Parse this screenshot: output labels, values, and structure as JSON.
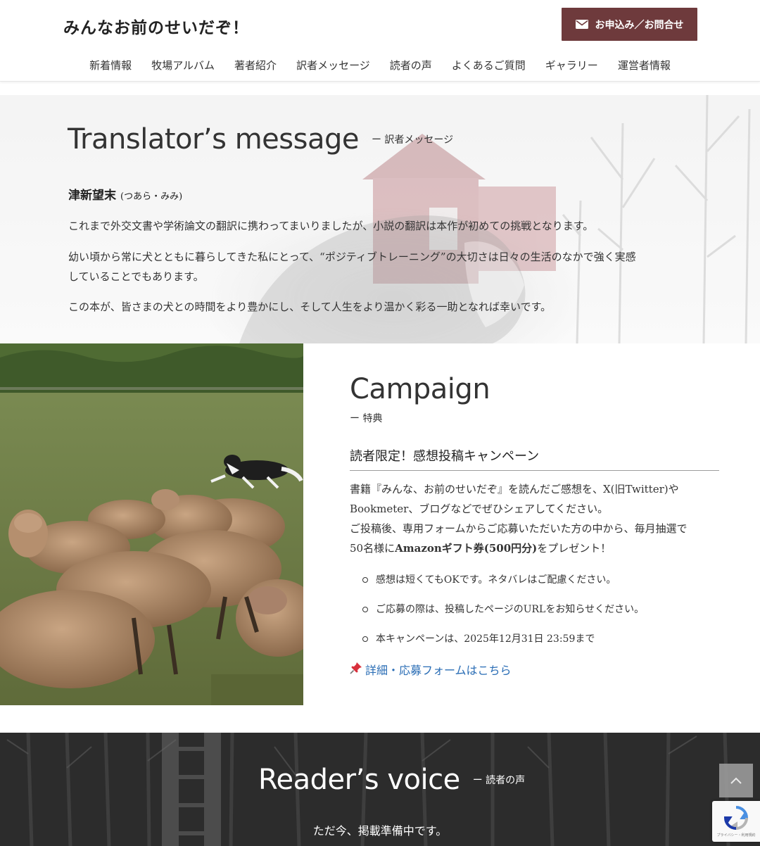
{
  "header": {
    "site_title": "みんなお前のせいだぞ！",
    "cta_label": "お申込み／お問合せ",
    "nav": [
      "新着情報",
      "牧場アルバム",
      "著者紹介",
      "訳者メッセージ",
      "読者の声",
      "よくあるご質問",
      "ギャラリー",
      "運営者情報"
    ]
  },
  "translator": {
    "heading_en": "Translator’s message",
    "heading_jp": "ー 訳者メッセージ",
    "name": "津新望末",
    "reading": "(つあら・みみ)",
    "paragraphs": [
      "これまで外交文書や学術論文の翻訳に携わってまいりましたが、小説の翻訳は本作が初めての挑戦となります。",
      "幼い頃から常に犬とともに暮らしてきた私にとって、“ポジティブトレーニング”の大切さは日々の生活のなかで強く実感",
      "していることでもあります。",
      "この本が、皆さまの犬との時間をより豊かにし、そして人生をより温かく彩る一助となれば幸いです。"
    ]
  },
  "campaign": {
    "heading_en": "Campaign",
    "heading_jp": "ー 特典",
    "title": "読者限定！感想投稿キャンペーン",
    "body": [
      "書籍『みんな、お前のせいだぞ』を読んだご感想を、X(旧Twitter)や",
      "Bookmeter、ブログなどでぜひシェアしてください。",
      "ご投稿後、専用フォームからご応募いただいた方の中から、毎月抽選で",
      "50名様に",
      "Amazonギフト券(500円分)",
      "をプレゼント！"
    ],
    "list": [
      "感想は短くてもOKです。ネタバレはご配慮ください。",
      "ご応募の際は、投稿したページのURLをお知らせください。",
      "本キャンペーンは、2025年12月31日 23:59まで"
    ],
    "link_label": "詳細・応募フォームはこちら"
  },
  "voice": {
    "heading_en": "Reader’s voice",
    "heading_jp": "ー 読者の声",
    "text": "ただ今、掲載準備中です。"
  },
  "widgets": {
    "recaptcha_text": "プライバシー・利用規約"
  },
  "colors": {
    "cta_bg": "#6e3a3c",
    "link": "#2a6db5",
    "voice_bg": "#3a3a3a"
  }
}
